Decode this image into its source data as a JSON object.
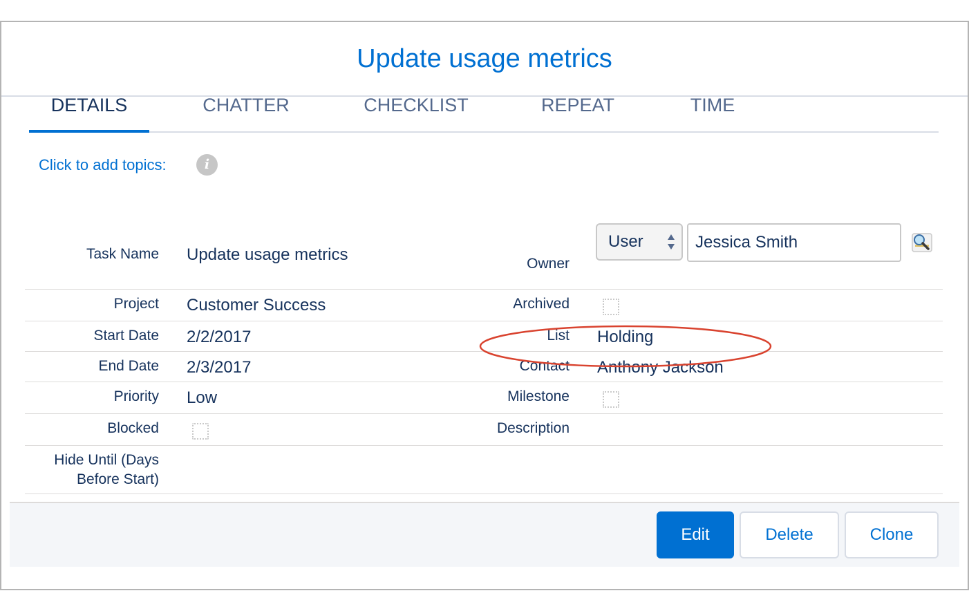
{
  "modal": {
    "title": "Update usage metrics"
  },
  "tabs": [
    {
      "label": "DETAILS",
      "active": true
    },
    {
      "label": "CHATTER",
      "active": false
    },
    {
      "label": "CHECKLIST",
      "active": false
    },
    {
      "label": "REPEAT",
      "active": false
    },
    {
      "label": "TIME",
      "active": false
    }
  ],
  "topics": {
    "link_label": "Click to add topics:",
    "icon": "info-icon"
  },
  "fields_left": {
    "task_name": {
      "label": "Task Name",
      "value": "Update usage metrics"
    },
    "project": {
      "label": "Project",
      "value": "Customer Success"
    },
    "start_date": {
      "label": "Start Date",
      "value": "2/2/2017"
    },
    "end_date": {
      "label": "End Date",
      "value": "2/3/2017"
    },
    "priority": {
      "label": "Priority",
      "value": "Low"
    },
    "blocked": {
      "label": "Blocked",
      "checked": false
    },
    "hide_until": {
      "label_line1": "Hide Until (Days",
      "label_line2": "Before Start)"
    }
  },
  "fields_right": {
    "owner": {
      "label": "Owner",
      "type_selected": "User",
      "value": "Jessica Smith",
      "lookup_icon": "lookup-magnifier-icon"
    },
    "archived": {
      "label": "Archived",
      "checked": false
    },
    "list": {
      "label": "List",
      "value": "Holding"
    },
    "contact": {
      "label": "Contact",
      "value": "Anthony Jackson",
      "highlighted": true
    },
    "milestone": {
      "label": "Milestone",
      "checked": false
    },
    "description": {
      "label": "Description"
    }
  },
  "footer": {
    "edit_label": "Edit",
    "delete_label": "Delete",
    "clone_label": "Clone"
  },
  "colors": {
    "accent": "#0070d2",
    "text": "#16325c",
    "tab_inactive": "#54698d",
    "highlight": "#d9432f"
  }
}
